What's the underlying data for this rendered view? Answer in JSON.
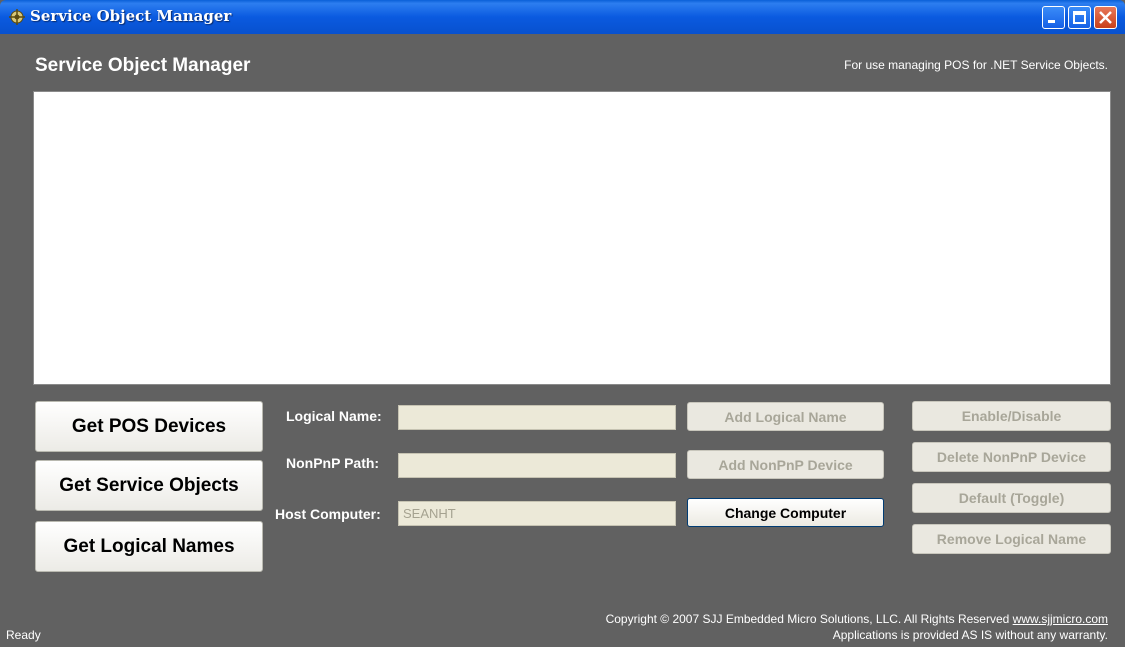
{
  "window": {
    "title": "Service Object Manager",
    "colors": {
      "titlebar": "#0a5ae0",
      "background": "#616161",
      "panel": "#ffffff"
    }
  },
  "header": {
    "title": "Service Object Manager",
    "subtitle": "For use managing POS for .NET Service Objects."
  },
  "actions": {
    "get_pos_devices": "Get POS Devices",
    "get_service_objects": "Get Service Objects",
    "get_logical_names": "Get Logical Names"
  },
  "form": {
    "logical_name_label": "Logical Name:",
    "logical_name_value": "",
    "nonpnp_path_label": "NonPnP Path:",
    "nonpnp_path_value": "",
    "host_computer_label": "Host Computer:",
    "host_computer_value": "SEANHT"
  },
  "middle_buttons": {
    "add_logical_name": "Add Logical Name",
    "add_nonpnp_device": "Add NonPnP Device",
    "change_computer": "Change Computer"
  },
  "right_buttons": {
    "enable_disable": "Enable/Disable",
    "delete_nonpnp_device": "Delete NonPnP Device",
    "default_toggle": "Default (Toggle)",
    "remove_logical_name": "Remove Logical Name"
  },
  "status": {
    "text": "Ready"
  },
  "footer": {
    "copyright_prefix": "Copyright © 2007 SJJ Embedded Micro Solutions, LLC. All Rights Reserved",
    "link": "www.sjjmicro.com",
    "disclaimer": "Applications is provided AS IS without any warranty."
  }
}
